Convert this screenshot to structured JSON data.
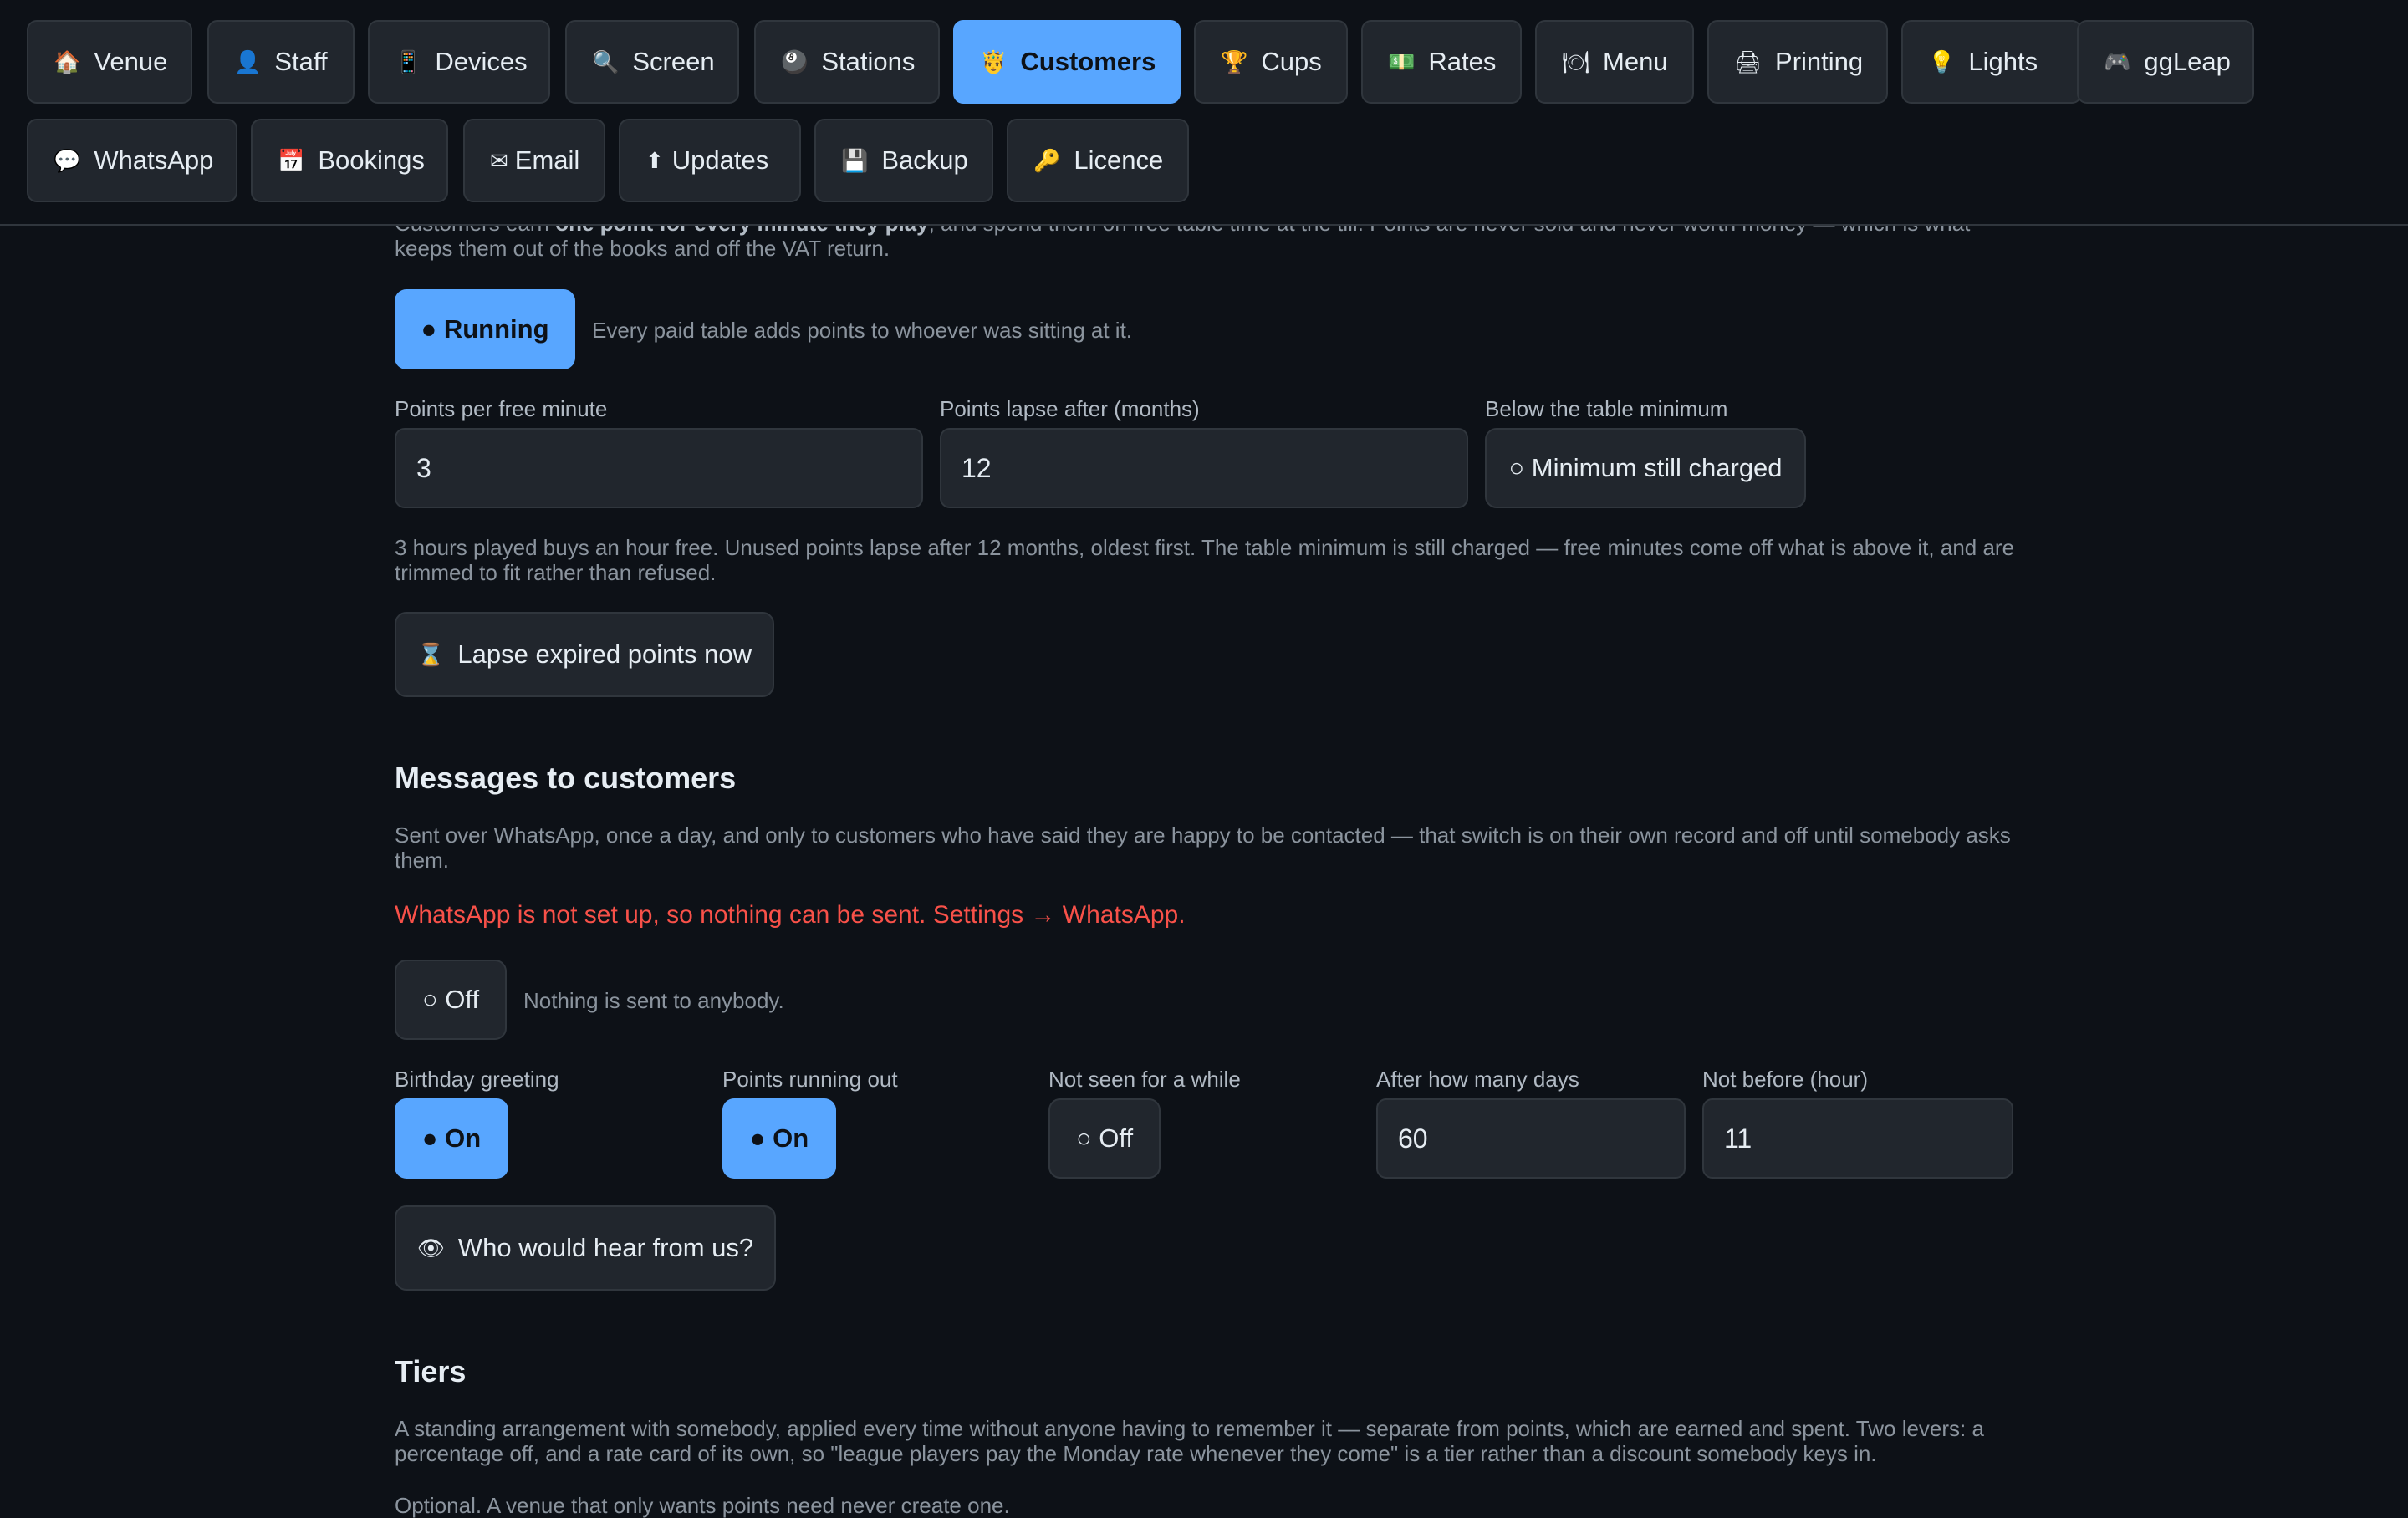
{
  "nav": {
    "tabs_row1": [
      {
        "icon": "🏠",
        "label": "Venue",
        "icon_name": "house-icon"
      },
      {
        "icon": "👤",
        "label": "Staff",
        "icon_name": "person-icon"
      },
      {
        "icon": "📱",
        "label": "Devices",
        "icon_name": "phone-icon"
      },
      {
        "icon": "🔍",
        "label": "Screen",
        "icon_name": "magnifier-icon"
      },
      {
        "icon": "🎱",
        "label": "Stations",
        "icon_name": "eight-ball-icon"
      },
      {
        "icon": "🤴",
        "label": "Customers",
        "icon_name": "customer-icon"
      },
      {
        "icon": "🏆",
        "label": "Cups",
        "icon_name": "trophy-icon"
      },
      {
        "icon": "💵",
        "label": "Rates",
        "icon_name": "banknote-icon"
      },
      {
        "icon": "🍽",
        "label": "Menu",
        "icon_name": "plate-icon"
      },
      {
        "icon": "🖨",
        "label": "Printing",
        "icon_name": "printer-icon"
      },
      {
        "icon": "💡",
        "label": "Lights",
        "icon_name": "bulb-icon"
      },
      {
        "icon": "🎮",
        "label": "ggLeap",
        "icon_name": "gamepad-icon"
      }
    ],
    "tabs_row2": [
      {
        "icon": "💬",
        "label": "WhatsApp",
        "icon_name": "speech-bubble-icon"
      },
      {
        "icon": "📅",
        "label": "Bookings",
        "icon_name": "calendar-icon"
      },
      {
        "icon": "✉",
        "label": "Email",
        "icon_name": "envelope-icon"
      },
      {
        "icon": "⬆",
        "label": "Updates",
        "icon_name": "up-arrow-icon"
      },
      {
        "icon": "💾",
        "label": "Backup",
        "icon_name": "floppy-disk-icon"
      },
      {
        "icon": "🔑",
        "label": "Licence",
        "icon_name": "key-icon"
      }
    ],
    "active": "Customers"
  },
  "points": {
    "intro_prefix": "Customers earn ",
    "intro_bold": "one point for every minute they play",
    "intro_suffix": ", and spend them on free table time at the till. Points are never sold and never worth money — which is what keeps them out of the books and off the VAT return.",
    "status_button": "● Running",
    "status_text": "Every paid table adds points to whoever was sitting at it.",
    "per_minute_label": "Points per free minute",
    "per_minute_value": "3",
    "lapse_label": "Points lapse after (months)",
    "lapse_value": "12",
    "minimum_label": "Below the table minimum",
    "minimum_button": "○ Minimum still charged",
    "summary": "3 hours played buys an hour free. Unused points lapse after 12 months, oldest first. The table minimum is still charged — free minutes come off what is above it, and are trimmed to fit rather than refused.",
    "lapse_button_icon": "⌛",
    "lapse_button_label": "Lapse expired points now"
  },
  "messages": {
    "heading": "Messages to customers",
    "description": "Sent over WhatsApp, once a day, and only to customers who have said they are happy to be contacted — that switch is on their own record and off until somebody asks them.",
    "warning": "WhatsApp is not set up, so nothing can be sent. Settings → WhatsApp.",
    "master_button": "○ Off",
    "master_text": "Nothing is sent to anybody.",
    "birthday_label": "Birthday greeting",
    "birthday_button": "● On",
    "running_out_label": "Points running out",
    "running_out_button": "● On",
    "not_seen_label": "Not seen for a while",
    "not_seen_button": "○ Off",
    "days_label": "After how many days",
    "days_value": "60",
    "hour_label": "Not before (hour)",
    "hour_value": "11",
    "preview_icon": "👁",
    "preview_label": "Who would hear from us?"
  },
  "tiers": {
    "heading": "Tiers",
    "description": "A standing arrangement with somebody, applied every time without anyone having to remember it — separate from points, which are earned and spent. Two levers: a percentage off, and a rate card of its own, so \"league players pay the Monday rate whenever they come\" is a tier rather than a discount somebody keys in.",
    "optional_note": "Optional. A venue that only wants points need never create one."
  },
  "colors": {
    "background": "#0d1117",
    "panel": "#21262d",
    "accent": "#58a6ff",
    "warning": "#f85149"
  }
}
